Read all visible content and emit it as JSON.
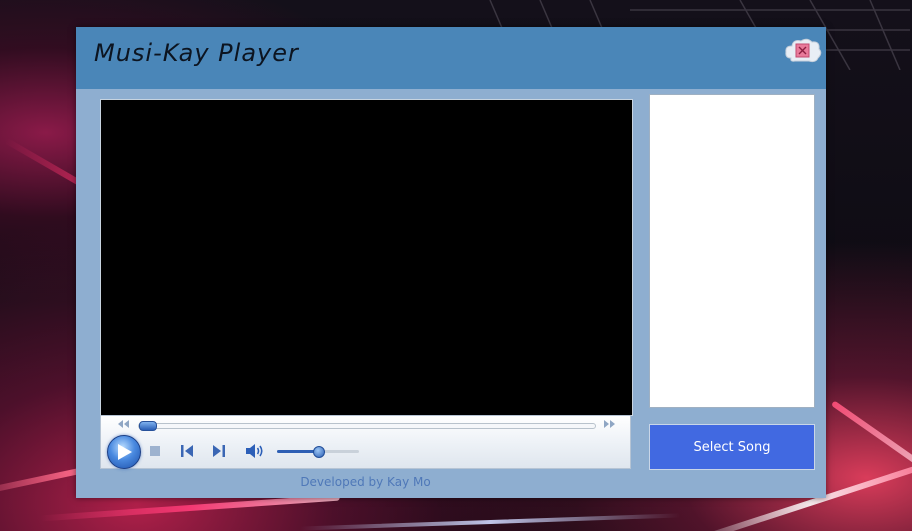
{
  "app": {
    "title": "Musi-Kay Player",
    "close_icon": "close-icon"
  },
  "player": {
    "seek_progress": 0.0,
    "volume_level": 0.5,
    "controls": [
      "play-icon",
      "stop-icon",
      "previous-icon",
      "next-icon",
      "speaker-icon"
    ]
  },
  "sidebar": {
    "select_song_label": "Select Song"
  },
  "footer": {
    "credit": "Developed by Kay Mo"
  },
  "colors": {
    "title_bar": "#4a86b8",
    "window_body": "#8eaed0",
    "select_button": "#4169e1",
    "credit_text": "#4f78b8"
  }
}
